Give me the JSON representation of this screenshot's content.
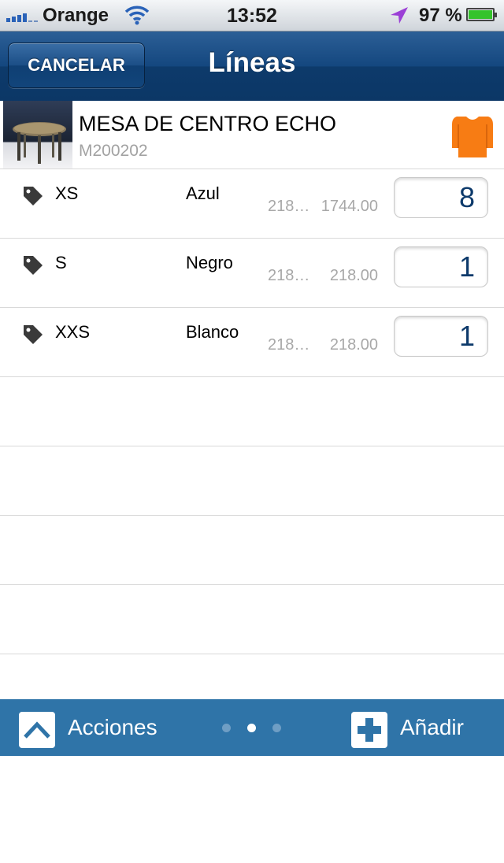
{
  "status_bar": {
    "carrier": "Orange",
    "time": "13:52",
    "battery_text": "97 %",
    "battery_level": 0.97
  },
  "nav": {
    "title": "Líneas",
    "cancel_label": "CANCELAR"
  },
  "product": {
    "name": "MESA DE CENTRO ECHO",
    "code": "M200202",
    "thumbnail_icon": "table-thumbnail",
    "category_icon": "shirt-icon",
    "category_color": "#f77c14"
  },
  "lines": [
    {
      "size": "XS",
      "color": "Azul",
      "unit_price": "218…",
      "total": "1744.00",
      "quantity": "8"
    },
    {
      "size": "S",
      "color": "Negro",
      "unit_price": "218…",
      "total": "218.00",
      "quantity": "1"
    },
    {
      "size": "XXS",
      "color": "Blanco",
      "unit_price": "218…",
      "total": "218.00",
      "quantity": "1"
    }
  ],
  "toolbar": {
    "actions_label": "Acciones",
    "actions_icon": "chevron-up-icon",
    "add_label": "Añadir",
    "add_icon": "plus-icon",
    "page_count": 3,
    "current_page": 2
  },
  "colors": {
    "nav_blue": "#14477f",
    "toolbar_blue": "#2f74a8",
    "quantity_text": "#0d3a6b"
  }
}
